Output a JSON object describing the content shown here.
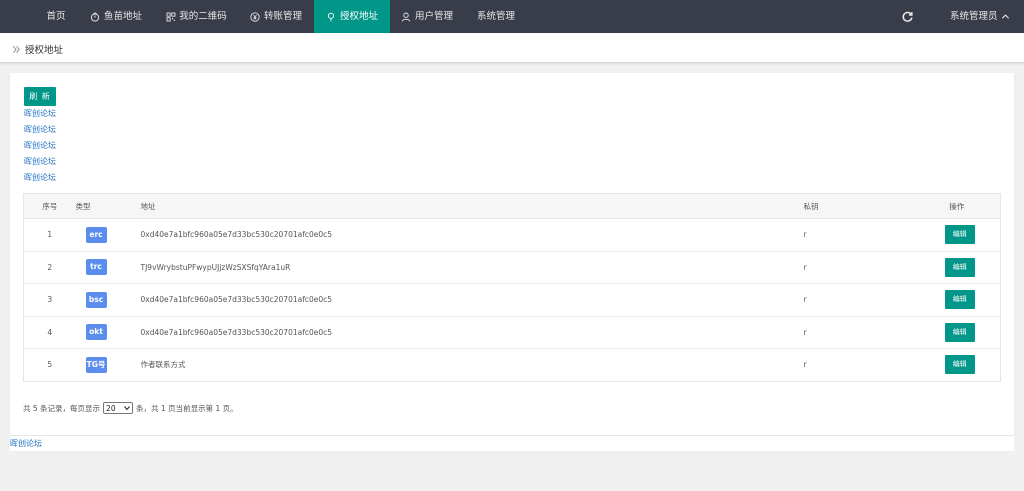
{
  "nav": {
    "items": [
      {
        "label": "首页",
        "icon": "none"
      },
      {
        "label": "鱼苗地址",
        "icon": "timer-icon"
      },
      {
        "label": "我的二维码",
        "icon": "qrcode-icon"
      },
      {
        "label": "转账管理",
        "icon": "yen-icon"
      },
      {
        "label": "授权地址",
        "icon": "location-icon",
        "active": true
      },
      {
        "label": "用户管理",
        "icon": "user-icon"
      },
      {
        "label": "系统管理",
        "icon": "none"
      }
    ],
    "admin_label": "系统管理员",
    "active_color": "#009688",
    "bar_color": "#393d49"
  },
  "breadcrumb": {
    "label": "授权地址"
  },
  "toolbar": {
    "refresh_label": "刷 新"
  },
  "links": [
    "晖创论坛",
    "晖创论坛",
    "晖创论坛",
    "晖创论坛",
    "晖创论坛"
  ],
  "table": {
    "headers": {
      "no": "序号",
      "type": "类型",
      "address": "地址",
      "key": "私钥",
      "op": "操作"
    },
    "rows": [
      {
        "no": "1",
        "type": "erc",
        "address": "0xd40e7a1bfc960a05e7d33bc530c20701afc0e0c5",
        "key": "r",
        "op": "编辑"
      },
      {
        "no": "2",
        "type": "trc",
        "address": "TJ9vWrybstuPFwypUJjzWzSXSfqYAra1uR",
        "key": "r",
        "op": "编辑"
      },
      {
        "no": "3",
        "type": "bsc",
        "address": "0xd40e7a1bfc960a05e7d33bc530c20701afc0e0c5",
        "key": "r",
        "op": "编辑"
      },
      {
        "no": "4",
        "type": "okt",
        "address": "0xd40e7a1bfc960a05e7d33bc530c20701afc0e0c5",
        "key": "r",
        "op": "编辑"
      },
      {
        "no": "5",
        "type": "TG号",
        "address": "作者联系方式",
        "key": "r",
        "op": "编辑"
      }
    ]
  },
  "pager": {
    "prefix": "共 5 条记录，每页显示",
    "page_size": "20",
    "suffix": "条，共 1 页当前显示第 1 页。"
  },
  "footer": {
    "link": "晖创论坛"
  },
  "colors": {
    "accent": "#009688",
    "badge": "#5b8def",
    "link": "#1e6fbf"
  }
}
